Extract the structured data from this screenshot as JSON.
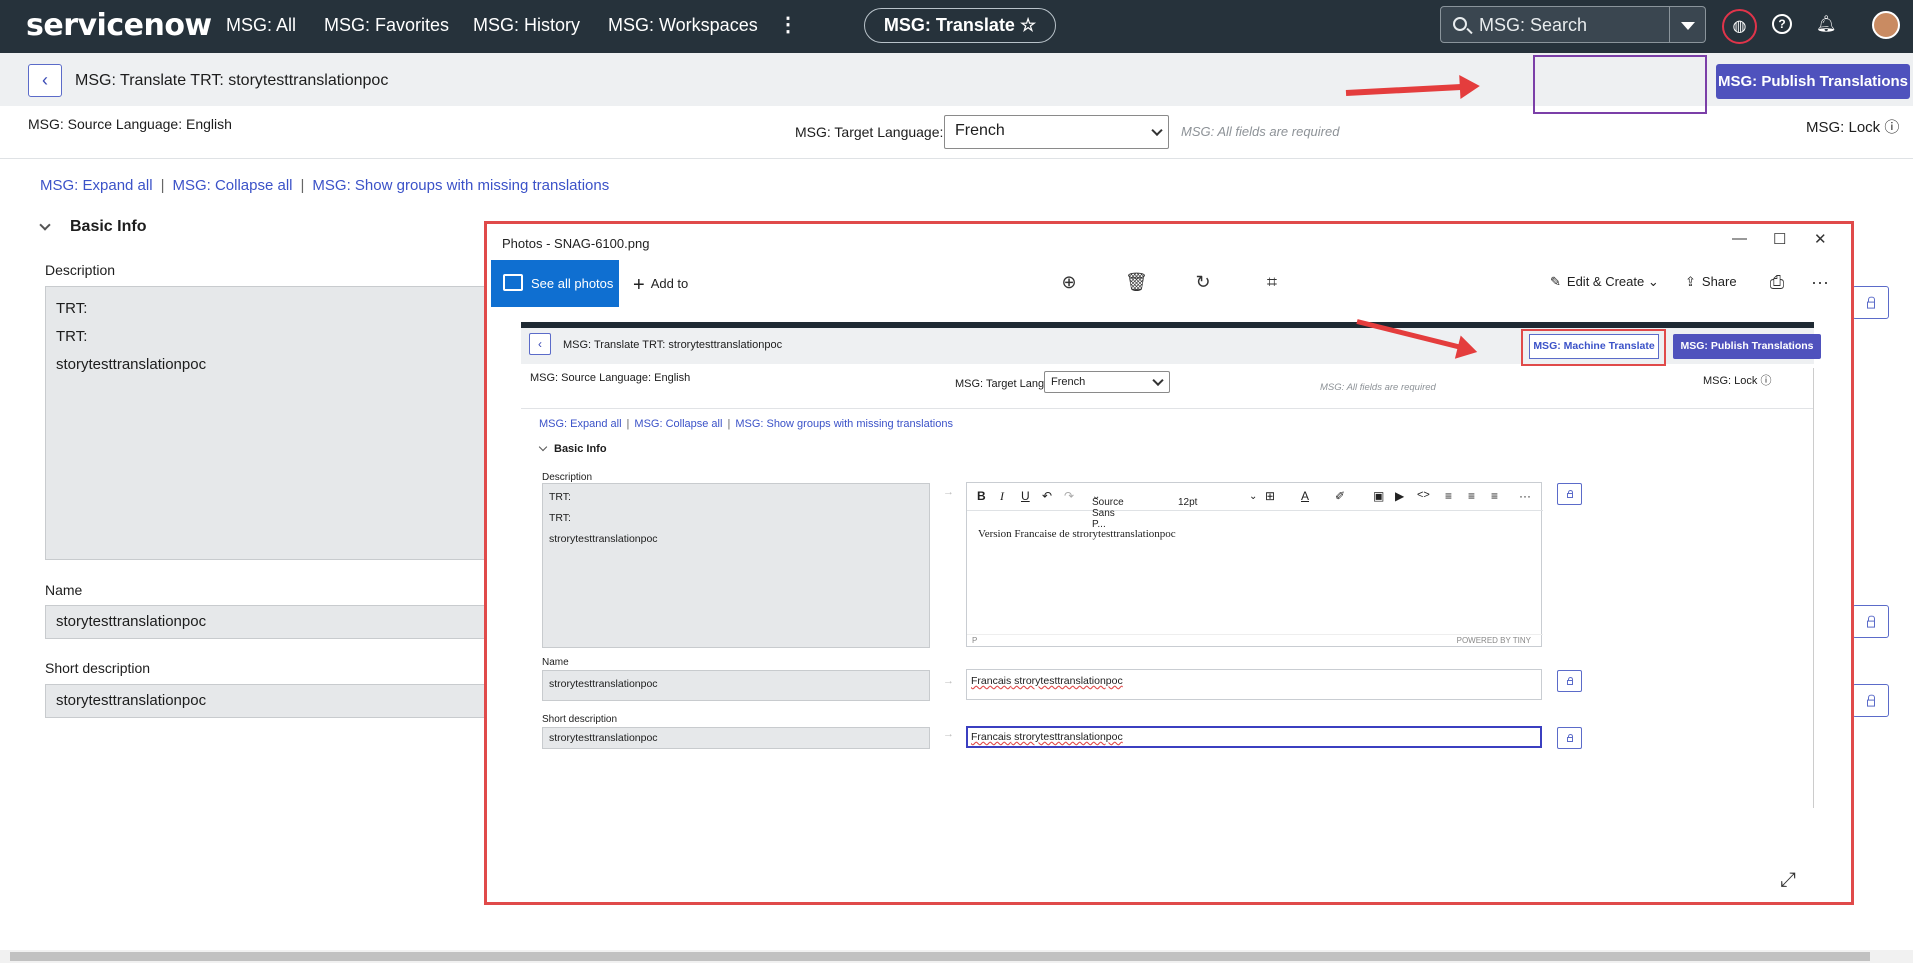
{
  "nav": {
    "logo": "servicenow",
    "links": [
      "MSG: All",
      "MSG: Favorites",
      "MSG: History",
      "MSG: Workspaces"
    ],
    "more": "⋮",
    "pill": "MSG: Translate ☆",
    "search_placeholder": "MSG: Search"
  },
  "header": {
    "back": "‹",
    "title": "MSG: Translate TRT: storytesttranslationpoc",
    "publish": "MSG: Publish Translations"
  },
  "lang": {
    "source": "MSG: Source Language: English",
    "target_label": "MSG: Target Language:",
    "target_value": "French",
    "required": "MSG: All fields are required",
    "lock": "MSG: Lock ⓘ"
  },
  "links": {
    "expand": "MSG: Expand all",
    "collapse": "MSG: Collapse all",
    "missing": "MSG: Show groups with missing translations"
  },
  "section": {
    "title": "Basic Info",
    "description_label": "Description",
    "description_lines": [
      "TRT:",
      "TRT:",
      "storytesttranslationpoc"
    ],
    "name_label": "Name",
    "name_value": "storytesttranslationpoc",
    "short_label": "Short description",
    "short_value": "storytesttranslationpoc"
  },
  "photos": {
    "title": "Photos - SNAG-6100.png",
    "min": "—",
    "max": "☐",
    "close": "✕",
    "see_all": "See all photos",
    "add_to": "Add to",
    "edit_create": "Edit & Create ⌄",
    "share": "Share",
    "more": "···",
    "expand": "⤢"
  },
  "inner": {
    "back": "‹",
    "title": "MSG: Translate TRT: strorytesttranslationpoc",
    "machine_translate": "MSG: Machine Translate",
    "publish": "MSG: Publish Translations",
    "source": "MSG: Source Language: English",
    "target_label": "MSG: Target Language:",
    "target_value": "French",
    "required": "MSG: All fields are required",
    "lock": "MSG: Lock ⓘ",
    "expand": "MSG: Expand all",
    "collapse": "MSG: Collapse all",
    "missing": "MSG: Show groups with missing translations",
    "section": "Basic Info",
    "description_label": "Description",
    "description_lines": [
      "TRT:",
      "TRT:",
      "strorytesttranslationpoc"
    ],
    "editor_font": "Source Sans P...",
    "editor_size": "12pt",
    "editor_text": "Version Francaise   de strorytesttranslationpoc",
    "editor_status": "P",
    "editor_powered": "POWERED BY TINY",
    "name_label": "Name",
    "name_value": "strorytesttranslationpoc",
    "name_translation_word": "Francais",
    "name_translation_rest": " strorytesttranslationpoc",
    "short_label": "Short description",
    "short_value": "strorytesttranslationpoc",
    "short_translation_word": "Francais",
    "short_translation_rest": " strorytesttranslationpoc"
  },
  "colors": {
    "accent": "#4f52bd",
    "link": "#3b52c8",
    "highlight": "#e04a4a"
  }
}
